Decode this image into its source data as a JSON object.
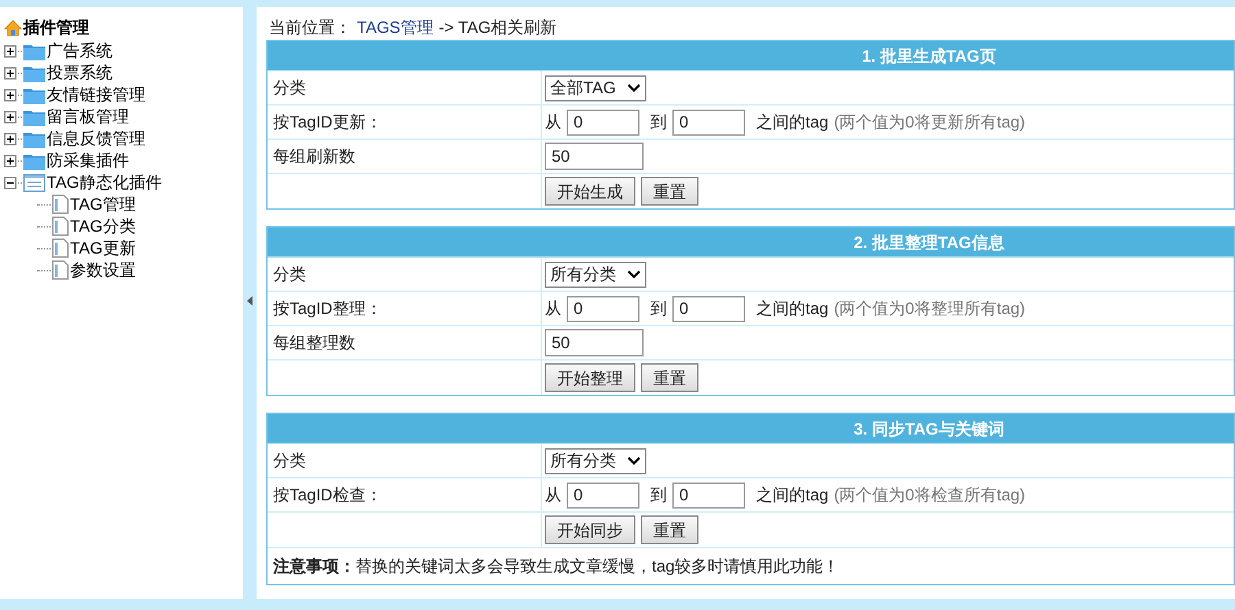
{
  "sidebar": {
    "title": "插件管理",
    "items": [
      {
        "label": "广告系统",
        "expanded": false
      },
      {
        "label": "投票系统",
        "expanded": false
      },
      {
        "label": "友情链接管理",
        "expanded": false
      },
      {
        "label": "留言板管理",
        "expanded": false
      },
      {
        "label": "信息反馈管理",
        "expanded": false
      },
      {
        "label": "防采集插件",
        "expanded": false
      },
      {
        "label": "TAG静态化插件",
        "expanded": true,
        "children": [
          {
            "label": "TAG管理"
          },
          {
            "label": "TAG分类"
          },
          {
            "label": "TAG更新"
          },
          {
            "label": "参数设置"
          }
        ]
      }
    ]
  },
  "breadcrumb": {
    "prefix": "当前位置：",
    "link": "TAGS管理",
    "rest": "-> TAG相关刷新"
  },
  "sections": [
    {
      "title": "1. 批里生成TAG页",
      "rows": [
        {
          "kind": "select",
          "label": "分类",
          "value": "全部TAG"
        },
        {
          "kind": "range",
          "label": "按TagID更新：",
          "from_label": "从",
          "from": "0",
          "to_label": "到",
          "to": "0",
          "suffix": "之间的tag",
          "hint": "(两个值为0将更新所有tag)"
        },
        {
          "kind": "number",
          "label": "每组刷新数",
          "value": "50"
        },
        {
          "kind": "buttons",
          "buttons": [
            "开始生成",
            "重置"
          ]
        }
      ]
    },
    {
      "title": "2. 批里整理TAG信息",
      "rows": [
        {
          "kind": "select",
          "label": "分类",
          "value": "所有分类"
        },
        {
          "kind": "range",
          "label": "按TagID整理：",
          "from_label": "从",
          "from": "0",
          "to_label": "到",
          "to": "0",
          "suffix": "之间的tag",
          "hint": "(两个值为0将整理所有tag)"
        },
        {
          "kind": "number",
          "label": "每组整理数",
          "value": "50"
        },
        {
          "kind": "buttons",
          "buttons": [
            "开始整理",
            "重置"
          ]
        }
      ]
    },
    {
      "title": "3. 同步TAG与关键词",
      "rows": [
        {
          "kind": "select",
          "label": "分类",
          "value": "所有分类"
        },
        {
          "kind": "range",
          "label": "按TagID检查：",
          "from_label": "从",
          "from": "0",
          "to_label": "到",
          "to": "0",
          "suffix": "之间的tag",
          "hint": "(两个值为0将检查所有tag)"
        },
        {
          "kind": "buttons",
          "buttons": [
            "开始同步",
            "重置"
          ]
        },
        {
          "kind": "note",
          "text": "**注意事项：**替换的关键词太多会导致生成文章缓慢，tag较多时请慎用此功能！"
        }
      ]
    }
  ]
}
